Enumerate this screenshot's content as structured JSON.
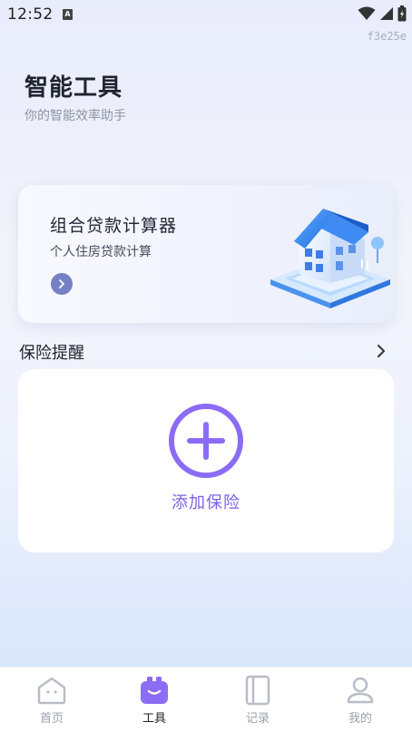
{
  "status_bar": {
    "time": "12:52",
    "notification_glyph": "A"
  },
  "build_tag": "f3e25e",
  "header": {
    "title": "智能工具",
    "subtitle": "你的智能效率助手"
  },
  "loan_card": {
    "title": "组合贷款计算器",
    "subtitle": "个人住房贷款计算",
    "icon": "chevron-right-icon",
    "illustration": "house-illustration"
  },
  "insurance_section": {
    "title": "保险提醒",
    "add_label": "添加保险",
    "add_icon": "plus-circle-icon"
  },
  "tab_bar": {
    "items": [
      {
        "label": "首页",
        "icon": "home-icon",
        "active": false
      },
      {
        "label": "工具",
        "icon": "toolbox-icon",
        "active": true
      },
      {
        "label": "记录",
        "icon": "notebook-icon",
        "active": false
      },
      {
        "label": "我的",
        "icon": "user-icon",
        "active": false
      }
    ]
  },
  "colors": {
    "accent": "#8b6cf5",
    "add_text": "#7b62e6",
    "loan_arrow": "#7581c4"
  }
}
